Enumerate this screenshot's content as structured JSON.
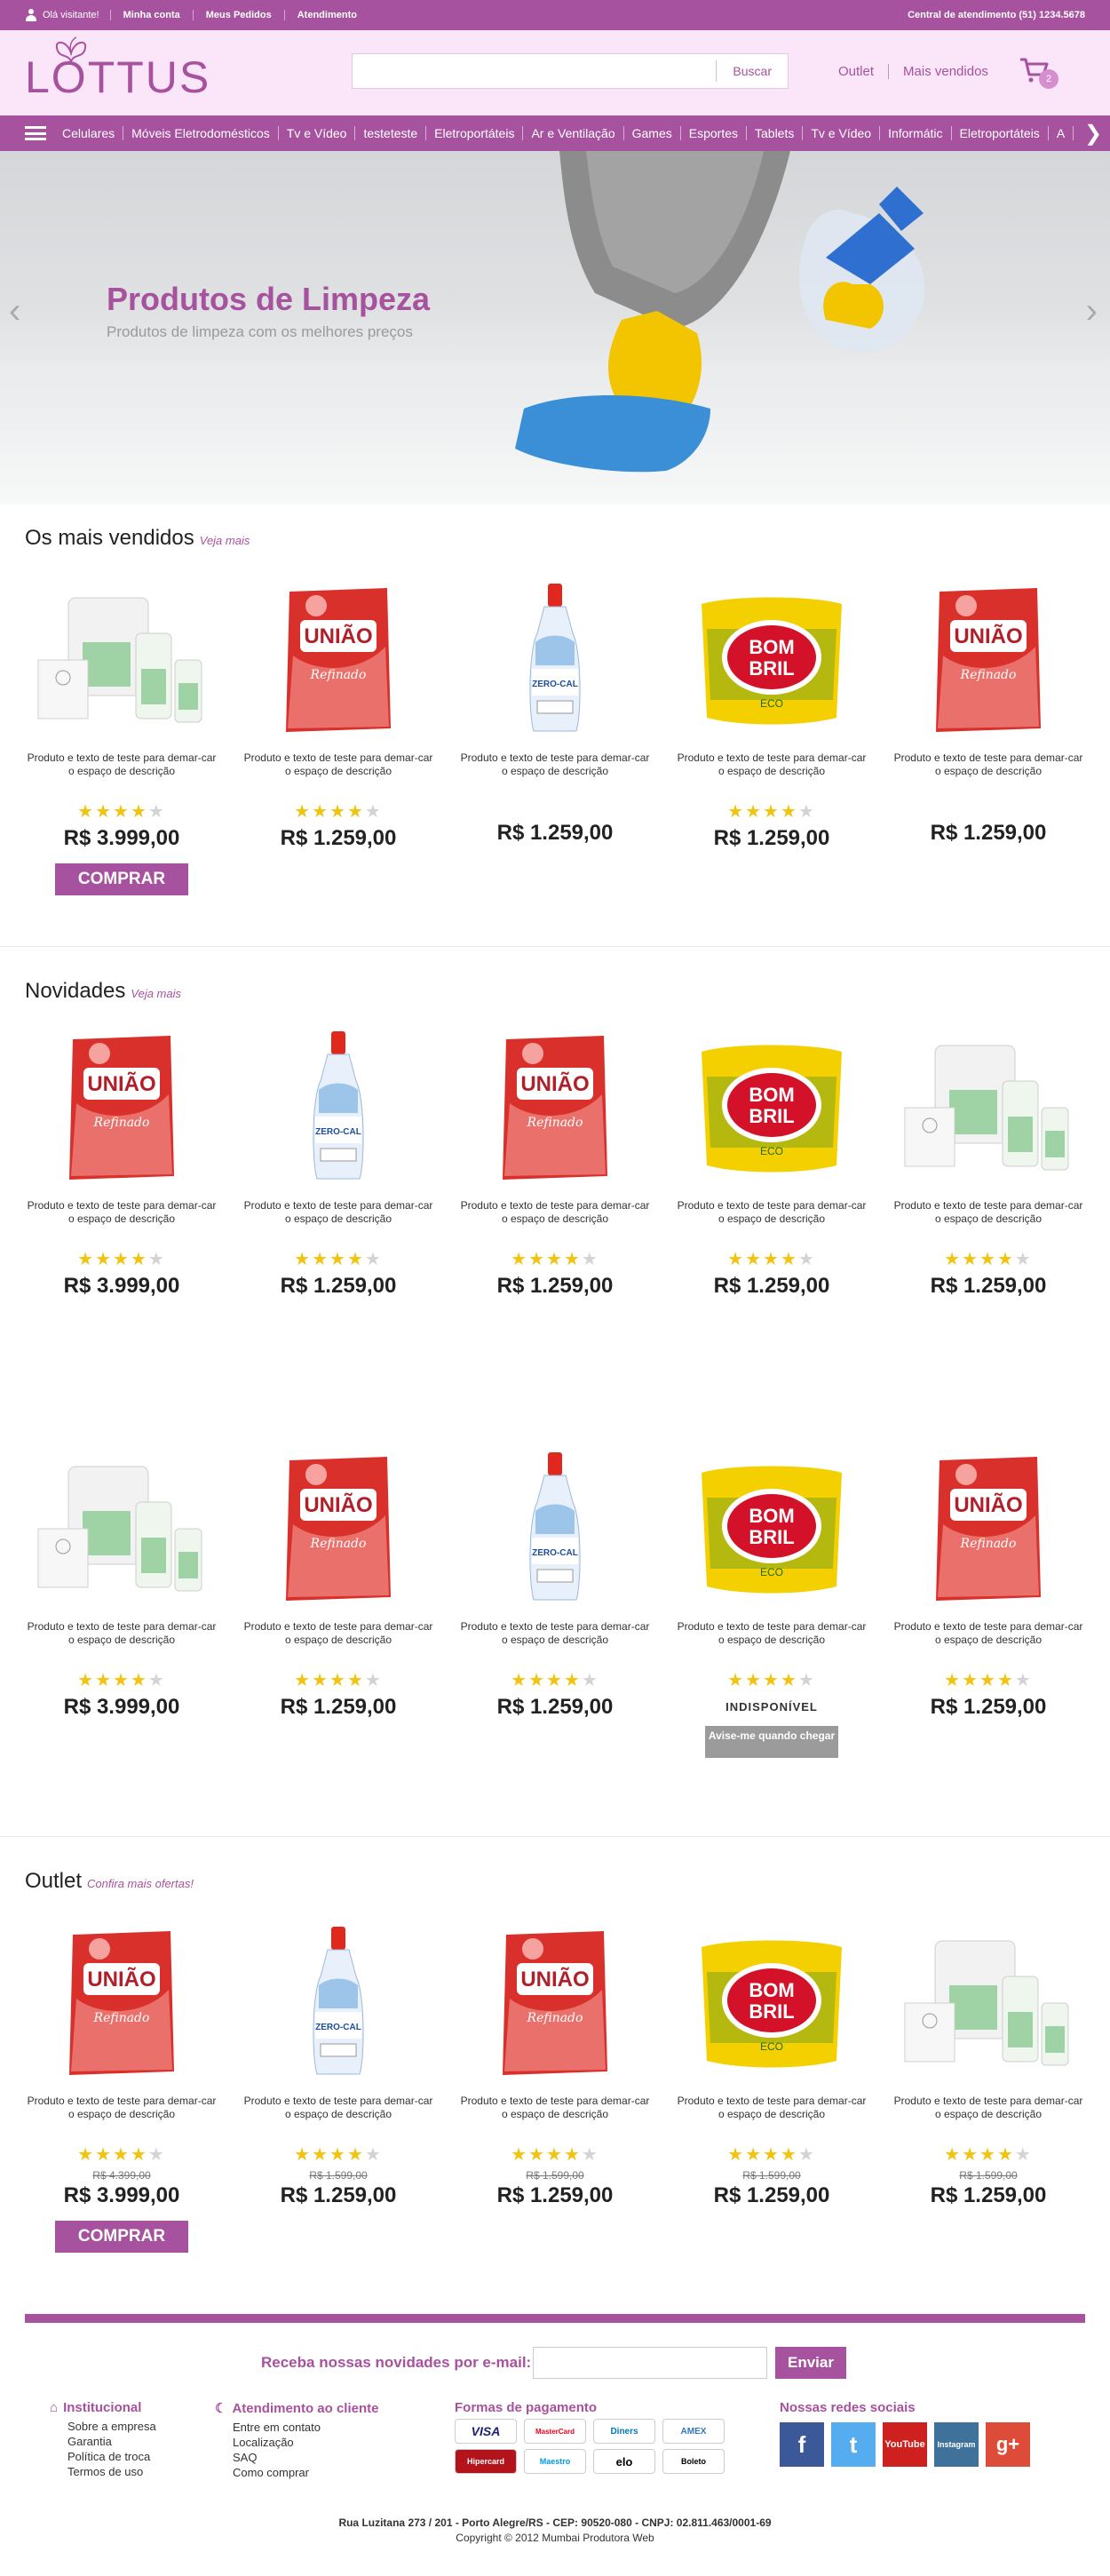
{
  "topbar": {
    "greeting": "Olá visitante!",
    "links": [
      "Minha conta",
      "Meus Pedidos",
      "Atendimento"
    ],
    "phone": "Central de atendimento (51) 1234.5678"
  },
  "header": {
    "logo_text": "LOTTUS",
    "search_button": "Buscar",
    "links": [
      "Outlet",
      "Mais vendidos"
    ],
    "cart_count": "2"
  },
  "categories": [
    "Celulares",
    "Móveis Eletrodomésticos",
    "Tv e Vídeo",
    "testeteste",
    "Eletroportáteis",
    "Ar e Ventilação",
    "Games",
    "Esportes",
    "Tablets",
    "Tv e Vídeo",
    "Informátic",
    "Eletroportáteis",
    "A"
  ],
  "banner": {
    "title": "Produtos de Limpeza",
    "subtitle": "Produtos de limpeza com os melhores preços"
  },
  "sections": [
    {
      "title": "Os mais vendidos",
      "link": "Veja mais",
      "rows": [
        [
          {
            "kind": "kit",
            "desc": "Produto e texto de teste para demar-car o espaço de descrição",
            "stars": 4,
            "price": "R$ 3.999,00",
            "button": "COMPRAR"
          },
          {
            "kind": "uniao",
            "desc": "Produto e texto de teste para demar-car o espaço de descrição",
            "stars": 4,
            "price": "R$ 1.259,00"
          },
          {
            "kind": "zerocal",
            "desc": "Produto e texto de teste para demar-car o espaço de descrição",
            "price": "R$ 1.259,00"
          },
          {
            "kind": "bombril",
            "desc": "Produto e texto de teste para demar-car o espaço de descrição",
            "stars": 4,
            "price": "R$ 1.259,00"
          },
          {
            "kind": "uniao",
            "desc": "Produto e texto de teste para demar-car o espaço de descrição",
            "price": "R$ 1.259,00"
          }
        ]
      ]
    },
    {
      "title": "Novidades",
      "link": "Veja mais",
      "rows": [
        [
          {
            "kind": "uniao",
            "desc": "Produto e texto de teste para demar-car o espaço de descrição",
            "stars": 4,
            "price": "R$ 3.999,00"
          },
          {
            "kind": "zerocal",
            "desc": "Produto e texto de teste para demar-car o espaço de descrição",
            "stars": 4,
            "price": "R$ 1.259,00"
          },
          {
            "kind": "uniao",
            "desc": "Produto e texto de teste para demar-car o espaço de descrição",
            "stars": 4,
            "price": "R$ 1.259,00"
          },
          {
            "kind": "bombril",
            "desc": "Produto e texto de teste para demar-car o espaço de descrição",
            "stars": 4,
            "price": "R$ 1.259,00"
          },
          {
            "kind": "kit",
            "desc": "Produto e texto de teste para demar-car o espaço de descrição",
            "stars": 4,
            "price": "R$ 1.259,00"
          }
        ],
        [
          {
            "kind": "kit",
            "desc": "Produto e texto de teste para demar-car o espaço de descrição",
            "stars": 4,
            "price": "R$ 3.999,00"
          },
          {
            "kind": "uniao",
            "desc": "Produto e texto de teste para demar-car o espaço de descrição",
            "stars": 4,
            "price": "R$ 1.259,00"
          },
          {
            "kind": "zerocal",
            "desc": "Produto e texto de teste para demar-car o espaço de descrição",
            "stars": 4,
            "price": "R$ 1.259,00"
          },
          {
            "kind": "bombril",
            "desc": "Produto e texto de teste para demar-car o espaço de descrição",
            "stars": 4,
            "unavailable": "INDISPONÍVEL",
            "notify": "Avise-me quando chegar"
          },
          {
            "kind": "uniao",
            "desc": "Produto e texto de teste para demar-car o espaço de descrição",
            "stars": 4,
            "price": "R$ 1.259,00"
          }
        ]
      ]
    },
    {
      "title": "Outlet",
      "link": "Confira mais ofertas!",
      "rows": [
        [
          {
            "kind": "uniao",
            "desc": "Produto e texto de teste para demar-car o espaço de descrição",
            "stars": 4,
            "old": "R$ 4.399,00",
            "price": "R$ 3.999,00",
            "button": "COMPRAR"
          },
          {
            "kind": "zerocal",
            "desc": "Produto e texto de teste para demar-car o espaço de descrição",
            "stars": 4,
            "old": "R$ 1.599,00",
            "price": "R$ 1.259,00"
          },
          {
            "kind": "uniao",
            "desc": "Produto e texto de teste para demar-car o espaço de descrição",
            "stars": 4,
            "old": "R$ 1.599,00",
            "price": "R$ 1.259,00"
          },
          {
            "kind": "bombril",
            "desc": "Produto e texto de teste para demar-car o espaço de descrição",
            "stars": 4,
            "old": "R$ 1.599,00",
            "price": "R$ 1.259,00"
          },
          {
            "kind": "kit",
            "desc": "Produto e texto de teste para demar-car o espaço de descrição",
            "stars": 4,
            "old": "R$ 1.599,00",
            "price": "R$ 1.259,00"
          }
        ]
      ]
    }
  ],
  "footer": {
    "newsletter_label": "Receba nossas novidades por e-mail:",
    "newsletter_button": "Enviar",
    "institucional": {
      "title": "Institucional",
      "items": [
        "Sobre a empresa",
        "Garantia",
        "Política de troca",
        "Termos de uso"
      ]
    },
    "atendimento": {
      "title": "Atendimento ao cliente",
      "items": [
        "Entre em contato",
        "Localização",
        "SAQ",
        "Como comprar"
      ]
    },
    "pagamento": {
      "title": "Formas de pagamento",
      "items": [
        "VISA",
        "MasterCard",
        "Diners",
        "AMEX",
        "Hipercard",
        "Maestro",
        "elo",
        "Boleto"
      ]
    },
    "social": {
      "title": "Nossas redes sociais",
      "items": [
        "f",
        "t",
        "YouTube",
        "Instagram",
        "g+"
      ]
    },
    "address": "Rua Luzitana 273 / 201 - Porto Alegre/RS - CEP: 90520-080 - CNPJ: 02.811.463/0001-69",
    "copyright": "Copyright © 2012 Mumbai Produtora Web"
  },
  "colors": {
    "brand": "#a7529e",
    "header_bg": "#fbe5f8",
    "star": "#f1c40f"
  }
}
